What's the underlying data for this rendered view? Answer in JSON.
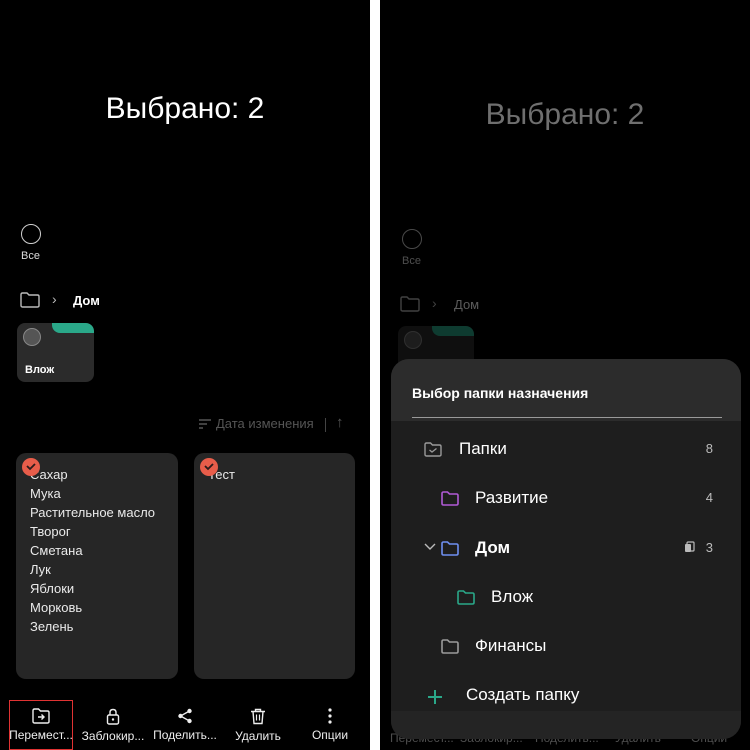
{
  "left": {
    "title": "Выбрано: 2",
    "all_label": "Все",
    "breadcrumb": "Дом",
    "folder_tile_label": "Влож",
    "sort_label": "Дата изменения",
    "notes": [
      {
        "lines": [
          "Сахар",
          "Мука",
          "Растительное масло",
          "Творог",
          "Сметана",
          "Лук",
          "Яблоки",
          "Морковь",
          "Зелень"
        ]
      },
      {
        "lines": [
          "Тест"
        ]
      }
    ],
    "toolbar": [
      {
        "label": "Перемест...",
        "icon": "folder-move-icon"
      },
      {
        "label": "Заблокир...",
        "icon": "lock-icon"
      },
      {
        "label": "Поделить...",
        "icon": "share-icon"
      },
      {
        "label": "Удалить",
        "icon": "trash-icon"
      },
      {
        "label": "Опции",
        "icon": "more-vertical-icon"
      }
    ]
  },
  "right": {
    "title": "Выбрано: 2",
    "all_label": "Все",
    "breadcrumb": "Дом",
    "sheet": {
      "title": "Выбор папки назначения",
      "items": [
        {
          "name": "Папки",
          "count": "8",
          "color": "#9a9a9a"
        },
        {
          "name": "Развитие",
          "count": "4",
          "color": "#b05ad6"
        },
        {
          "name": "Дом",
          "count": "3",
          "color": "#6f8ff0"
        },
        {
          "name": "Влож",
          "count": "",
          "color": "#2aa889"
        },
        {
          "name": "Финансы",
          "count": "",
          "color": "#9a9a9a"
        }
      ],
      "create_label": "Создать папку"
    },
    "toolbar_peek": [
      "Перемест...",
      "Заблокир...",
      "Поделить...",
      "Удалить",
      "Опции"
    ]
  },
  "colors": {
    "accent_green": "#2aa889",
    "check_red": "#e85d4a",
    "highlight_red": "#e03333"
  }
}
